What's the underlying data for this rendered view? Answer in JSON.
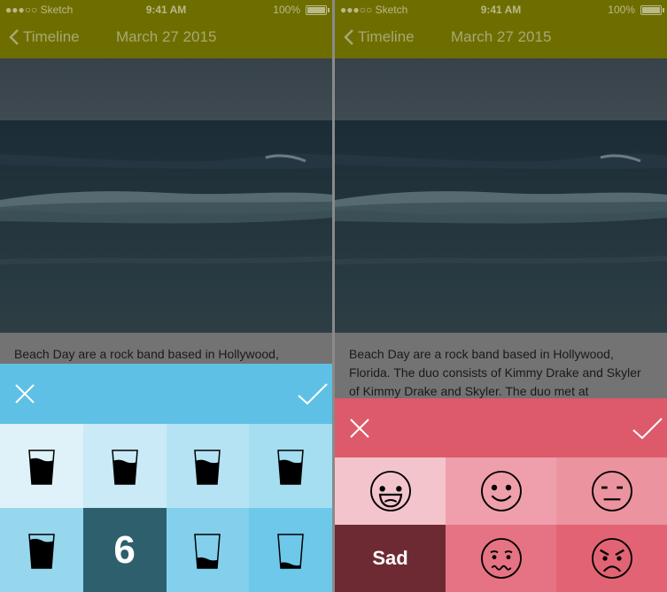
{
  "status_bar": {
    "carrier": "●●●○○ Sketch",
    "time": "9:41 AM",
    "battery": "100%"
  },
  "nav": {
    "back_label": "Timeline",
    "title": "March 27 2015"
  },
  "left_screen": {
    "article_text": "Beach Day are a rock band based in Hollywood,",
    "picker": {
      "accent": "#5ec0e4",
      "selected_value": "6",
      "cell_colors": [
        "#dff2fa",
        "#c9eaf6",
        "#b6e3f4",
        "#a5ddf1",
        "#96d7ee",
        "#2e5f6d",
        "#83d0ec",
        "#6ec8e9"
      ],
      "water_levels": [
        0.75,
        0.7,
        0.7,
        0.7,
        0.85,
        0.6,
        0.3,
        0.15
      ]
    }
  },
  "right_screen": {
    "article_text": "Beach Day are a rock band based in Hollywood, Florida. The duo consists of Kimmy Drake and Skyler of Kimmy Drake and Skyler. The duo met at",
    "picker": {
      "accent": "#dd5a6b",
      "selected_label": "Sad",
      "cell_colors": [
        "#f4c4cc",
        "#ef9fac",
        "#ec93a0",
        "#6e2a33",
        "#e57383",
        "#e26474"
      ],
      "moods": [
        "laughing-face",
        "smiling-face",
        "neutral-face",
        "sad-face",
        "worried-face",
        "angry-face"
      ]
    }
  }
}
